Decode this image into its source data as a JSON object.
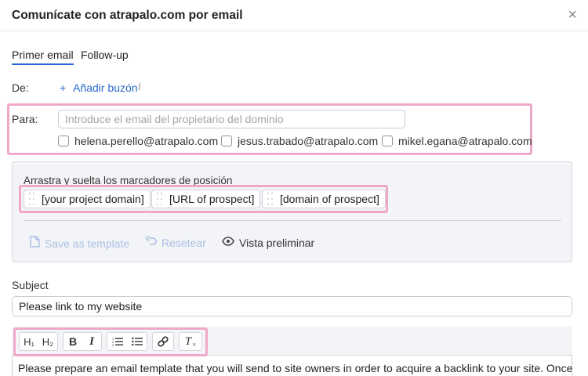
{
  "dialog": {
    "title": "Comunícate con atrapalo.com por email",
    "close_symbol": "×"
  },
  "tabs": [
    {
      "label": "Primer email",
      "active": true
    },
    {
      "label": "Follow-up",
      "active": false
    }
  ],
  "from": {
    "label": "De:",
    "add_mailbox": "Añadir buzón",
    "info_symbol": "i"
  },
  "to": {
    "label": "Para:",
    "placeholder": "Introduce el email del propietario del dominio",
    "value": "",
    "suggestions": [
      {
        "email": "helena.perello@atrapalo.com",
        "checked": false
      },
      {
        "email": "jesus.trabado@atrapalo.com",
        "checked": false
      },
      {
        "email": "mikel.egana@atrapalo.com",
        "checked": false
      }
    ]
  },
  "placeholders": {
    "heading": "Arrastra y suelta los marcadores de posición",
    "chips": [
      "[your project domain]",
      "[URL of prospect]",
      "[domain of prospect]"
    ]
  },
  "actions": {
    "save_template": "Save as template",
    "reset": "Resetear",
    "preview": "Vista preliminar"
  },
  "subject": {
    "label": "Subject",
    "value": "Please link to my website"
  },
  "editor": {
    "toolbar": {
      "h1": "H₁",
      "h2": "H₂",
      "bold": "B",
      "italic": "I",
      "clear_format": "T"
    },
    "body": "Please prepare an email template that you will send to site owners in order to acquire a backlink to your site. Once"
  },
  "colors": {
    "accent": "#2b6ad6",
    "highlight": "#f0a8c8",
    "disabled_action": "#a9c1e3"
  }
}
